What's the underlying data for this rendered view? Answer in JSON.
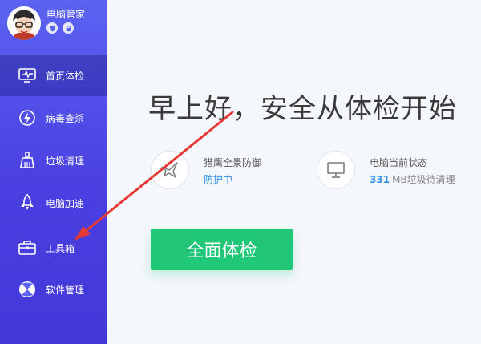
{
  "profile": {
    "name": "电脑管家"
  },
  "sidebar": {
    "items": [
      {
        "label": "首页体检",
        "icon": "monitor-pulse-icon"
      },
      {
        "label": "病毒查杀",
        "icon": "lightning-shield-icon"
      },
      {
        "label": "垃圾清理",
        "icon": "broom-icon"
      },
      {
        "label": "电脑加速",
        "icon": "rocket-icon"
      },
      {
        "label": "工具箱",
        "icon": "toolbox-icon"
      },
      {
        "label": "软件管理",
        "icon": "apps-icon"
      }
    ]
  },
  "main": {
    "greeting": "早上好，安全从体检开始",
    "protection": {
      "title": "猎鹰全景防御",
      "status": "防护中"
    },
    "pc_status": {
      "title": "电脑当前状态",
      "value": "331",
      "suffix": "MB垃圾待清理"
    },
    "scan_button": "全面体检"
  },
  "colors": {
    "sidebar": "#5b63f2",
    "accent_blue": "#2f8ee8",
    "scan_green": "#1fc776",
    "annotation_red": "#e53935"
  }
}
